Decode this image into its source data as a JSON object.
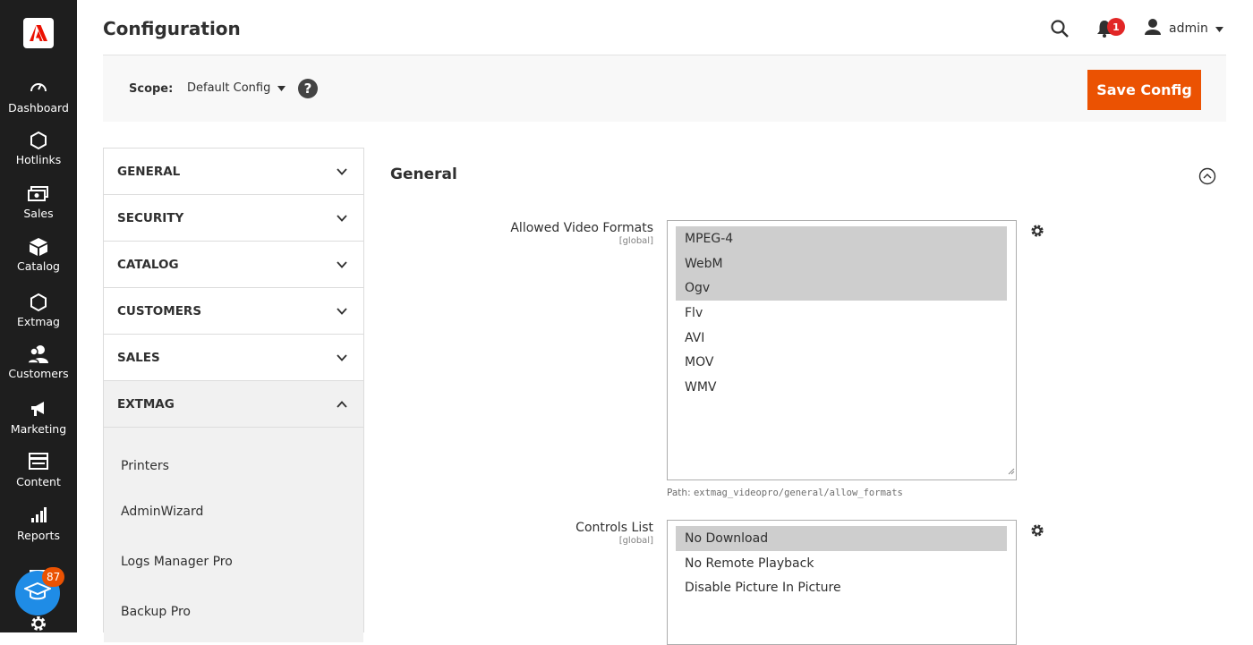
{
  "nav": {
    "items": [
      {
        "label": "Dashboard"
      },
      {
        "label": "Hotlinks"
      },
      {
        "label": "Sales"
      },
      {
        "label": "Catalog"
      },
      {
        "label": "Extmag"
      },
      {
        "label": "Customers"
      },
      {
        "label": "Marketing"
      },
      {
        "label": "Content"
      },
      {
        "label": "Reports"
      }
    ],
    "notification_count": "87"
  },
  "header": {
    "title": "Configuration",
    "notifications_count": "1",
    "user_name": "admin"
  },
  "scope": {
    "label": "Scope:",
    "value": "Default Config",
    "help": "?",
    "save_label": "Save Config"
  },
  "tabs": [
    {
      "label": "GENERAL"
    },
    {
      "label": "SECURITY"
    },
    {
      "label": "CATALOG"
    },
    {
      "label": "CUSTOMERS"
    },
    {
      "label": "SALES"
    },
    {
      "label": "EXTMAG"
    }
  ],
  "extmag_items": [
    {
      "label": "Printers"
    },
    {
      "label": "AdminWizard"
    },
    {
      "label": "Logs Manager Pro"
    },
    {
      "label": "Backup Pro"
    }
  ],
  "section": {
    "title": "General"
  },
  "fields": {
    "formats": {
      "label": "Allowed Video Formats",
      "scope": "[global]",
      "options": [
        {
          "label": "MPEG-4",
          "selected": true
        },
        {
          "label": "WebM",
          "selected": true
        },
        {
          "label": "Ogv",
          "selected": true
        },
        {
          "label": "Flv",
          "selected": false
        },
        {
          "label": "AVI",
          "selected": false
        },
        {
          "label": "MOV",
          "selected": false
        },
        {
          "label": "WMV",
          "selected": false
        }
      ],
      "path_prefix": "Path:",
      "path": "extmag_videopro/general/allow_formats"
    },
    "controls": {
      "label": "Controls List",
      "scope": "[global]",
      "options": [
        {
          "label": "No Download",
          "selected": true
        },
        {
          "label": "No Remote Playback",
          "selected": false
        },
        {
          "label": "Disable Picture In Picture",
          "selected": false
        }
      ]
    }
  }
}
